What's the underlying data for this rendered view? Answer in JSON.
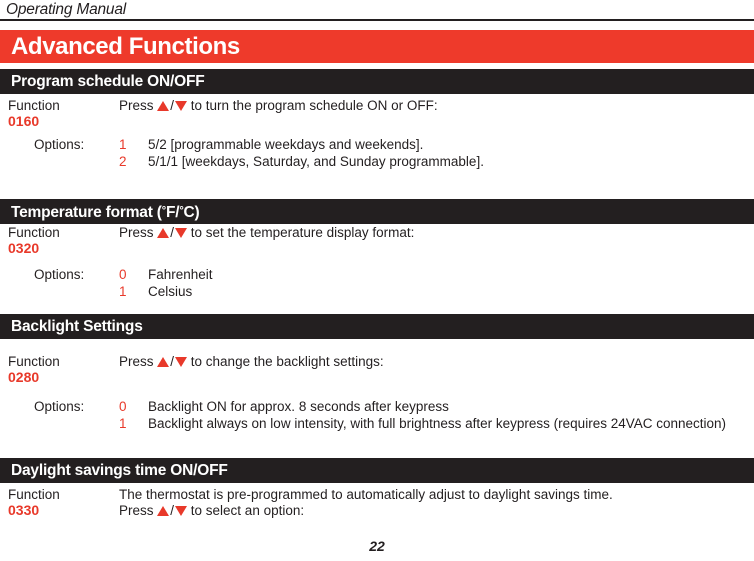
{
  "running_head": "Operating Manual",
  "chapter": {
    "title": "Advanced Functions",
    "banner_color": "#ee3a2b"
  },
  "accent_color": "#e8392a",
  "bar_color": "#231f20",
  "sections": [
    {
      "bar_title": "Program schedule ON/OFF",
      "function_label": "Function",
      "function_number": "0160",
      "instruction_prefix": "Press ",
      "instruction_suffix": " to turn the program schedule ON or OFF:",
      "options_label": "Options:",
      "options": [
        {
          "key": "1",
          "text": "5/2 [programmable weekdays and weekends]."
        },
        {
          "key": "2",
          "text": "5/1/1 [weekdays, Saturday, and Sunday programmable]."
        }
      ]
    },
    {
      "bar_title_pre": "Temperature format (",
      "bar_title_deg1": "°",
      "bar_title_f": "F/",
      "bar_title_deg2": "°",
      "bar_title_c": "C)",
      "bar_title": "Temperature format (°F/°C)",
      "function_label": "Function",
      "function_number": "0320",
      "instruction_prefix": "Press ",
      "instruction_suffix": " to set the temperature display format:",
      "options_label": "Options:",
      "options": [
        {
          "key": "0",
          "text": "Fahrenheit"
        },
        {
          "key": "1",
          "text": "Celsius"
        }
      ]
    },
    {
      "bar_title": "Backlight Settings",
      "function_label": "Function",
      "function_number": "0280",
      "instruction_prefix": "Press ",
      "instruction_suffix": " to change the backlight settings:",
      "options_label": "Options:",
      "options": [
        {
          "key": "0",
          "text": "Backlight ON for approx. 8 seconds after keypress"
        },
        {
          "key": "1",
          "text": "Backlight always on low intensity, with full brightness after keypress (requires 24VAC connection)"
        }
      ]
    },
    {
      "bar_title": "Daylight savings time ON/OFF",
      "function_label": "Function",
      "function_number": "0330",
      "body_line_1": "The thermostat is pre-programmed to automatically adjust to daylight savings time.",
      "instruction_prefix": "Press ",
      "instruction_suffix": " to select an option:"
    }
  ],
  "icons": {
    "up_arrow": "up-arrow-icon",
    "down_arrow": "down-arrow-icon",
    "slash": "/"
  },
  "folio": "22"
}
